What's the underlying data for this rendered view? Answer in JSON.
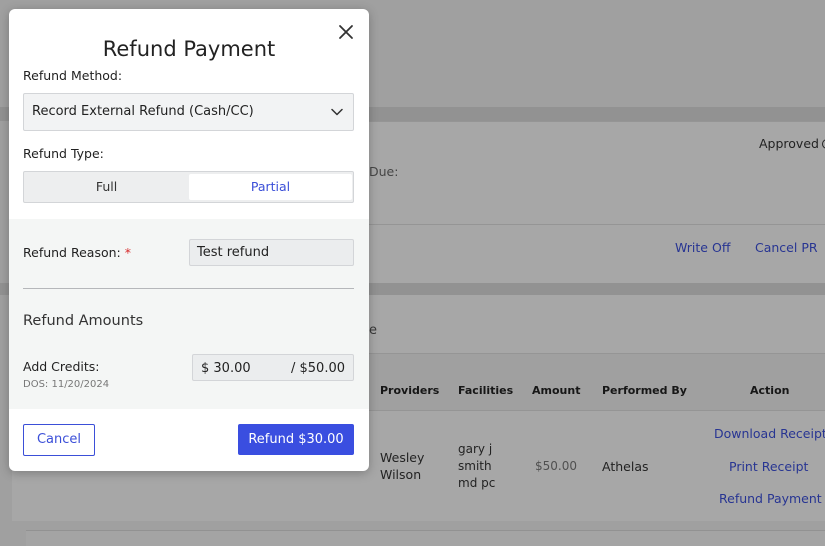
{
  "modal": {
    "title": "Refund Payment",
    "refund_method_label": "Refund Method:",
    "refund_method_value": "Record External Refund (Cash/CC)",
    "refund_type_label": "Refund Type:",
    "refund_type_options": [
      "Full",
      "Partial"
    ],
    "refund_type_selected": "Partial",
    "refund_reason_label": "Refund Reason:",
    "required_mark": "*",
    "refund_reason_value": "Test refund",
    "refund_amounts_title": "Refund Amounts",
    "add_credits_label": "Add Credits:",
    "dos_text": "DOS: 11/20/2024",
    "amount_value": "$ 30.00",
    "amount_max": "/ $50.00",
    "cancel_label": "Cancel",
    "refund_button_label": "Refund $30.00",
    "accent_color": "#3a4ee0",
    "required_color": "#d62b2b"
  },
  "background": {
    "approved_label": "Approved",
    "due_label": "Due:",
    "write_off_label": "Write Off",
    "cancel_pr_label": "Cancel PR",
    "partial_heading": "e",
    "table_headers": [
      "Providers",
      "Facilities",
      "Amount",
      "Performed By",
      "Action"
    ],
    "row": {
      "provider": "Wesley Wilson",
      "facility": "gary j smith md pc",
      "amount": "$50.00",
      "performed_by": "Athelas",
      "actions": [
        "Download Receipt",
        "Print Receipt",
        "Refund Payment"
      ]
    },
    "link_color": "#3b4fd8"
  }
}
